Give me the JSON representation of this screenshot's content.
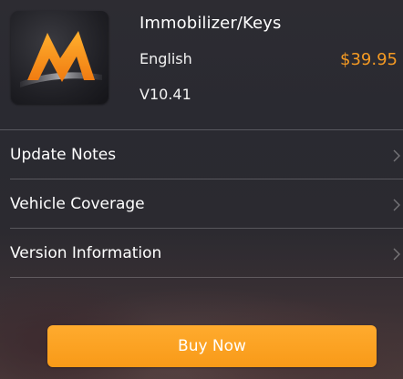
{
  "product": {
    "title": "Immobilizer/Keys",
    "language": "English",
    "version": "V10.41",
    "price": "$39.95",
    "icon": "m-logo-icon"
  },
  "menu": {
    "items": [
      {
        "label": "Update Notes",
        "icon": "chevron-right-icon"
      },
      {
        "label": "Vehicle Coverage",
        "icon": "chevron-right-icon"
      },
      {
        "label": "Version Information",
        "icon": "chevron-right-icon"
      }
    ]
  },
  "actions": {
    "buy_label": "Buy Now"
  },
  "colors": {
    "accent": "#f59a23",
    "button": "#f89a18",
    "text": "#ffffff",
    "background": "#2b2a30"
  }
}
